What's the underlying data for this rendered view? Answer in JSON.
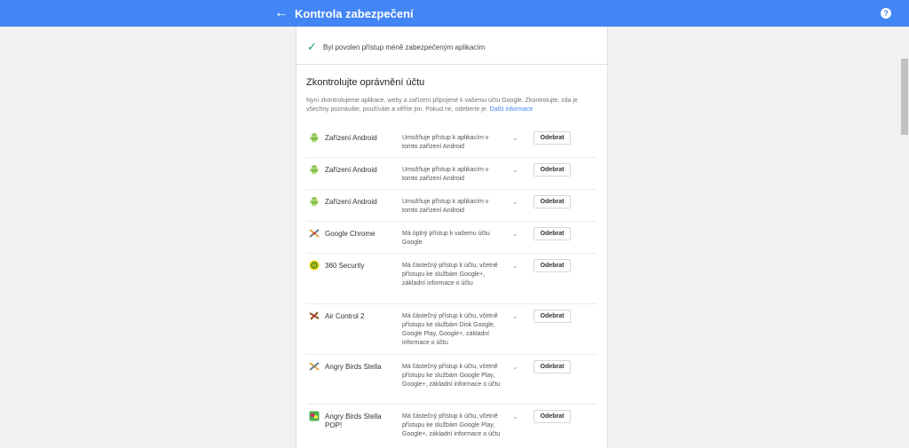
{
  "header": {
    "title": "Kontrola zabezpečení",
    "back_icon": "arrow-back-icon",
    "help_icon": "help-icon",
    "color": "#4285f4"
  },
  "status": {
    "text": "Byl povolen přístup méně zabezpečeným aplikacím"
  },
  "section": {
    "title": "Zkontrolujte oprávnění účtu",
    "description": "Nyní zkontrolujeme aplikace, weby a zařízení připojené k vašemu účtu Google. Zkontrolujte, zda je všechny poznáváte, používáte a věříte jim. Pokud ne, odeberte je.",
    "more_link": "Další informace"
  },
  "apps": [
    {
      "name": "Zařízení Android",
      "access": "Umožňuje přístup k aplikacím v tomto zařízení Android",
      "button": "Odebrat",
      "icon": "android-icon"
    },
    {
      "name": "Zařízení Android",
      "access": "Umožňuje přístup k aplikacím v tomto zařízení Android",
      "button": "Odebrat",
      "icon": "android-icon"
    },
    {
      "name": "Zařízení Android",
      "access": "Umožňuje přístup k aplikacím v tomto zařízení Android",
      "button": "Odebrat",
      "icon": "android-icon"
    },
    {
      "name": "Google Chrome",
      "access": "Má úplný přístup k vašemu účtu Google",
      "button": "Odebrat",
      "icon": "chrome-icon"
    },
    {
      "name": "360 Security",
      "access": "Má částečný přístup k účtu, včetně přístupu ke službám Google+, základní informace o účtu",
      "button": "Odebrat",
      "icon": "360-security-icon"
    },
    {
      "name": "Air Control 2",
      "access": "Má částečný přístup k účtu, včetně přístupu ke službám Disk Google, Google Play, Google+, základní informace o účtu",
      "button": "Odebrat",
      "icon": "air-control-icon"
    },
    {
      "name": "Angry Birds Stella",
      "access": "Má částečný přístup k účtu, včetně přístupu ke službám Google Play, Google+, základní informace o účtu",
      "button": "Odebrat",
      "icon": "angry-birds-icon"
    },
    {
      "name": "Angry Birds Stella POP!",
      "access": "Má částečný přístup k účtu, včetně přístupu ke službám Google Play, Google+, základní informace o účtu",
      "button": "Odebrat",
      "icon": "angry-birds-pop-icon"
    }
  ]
}
